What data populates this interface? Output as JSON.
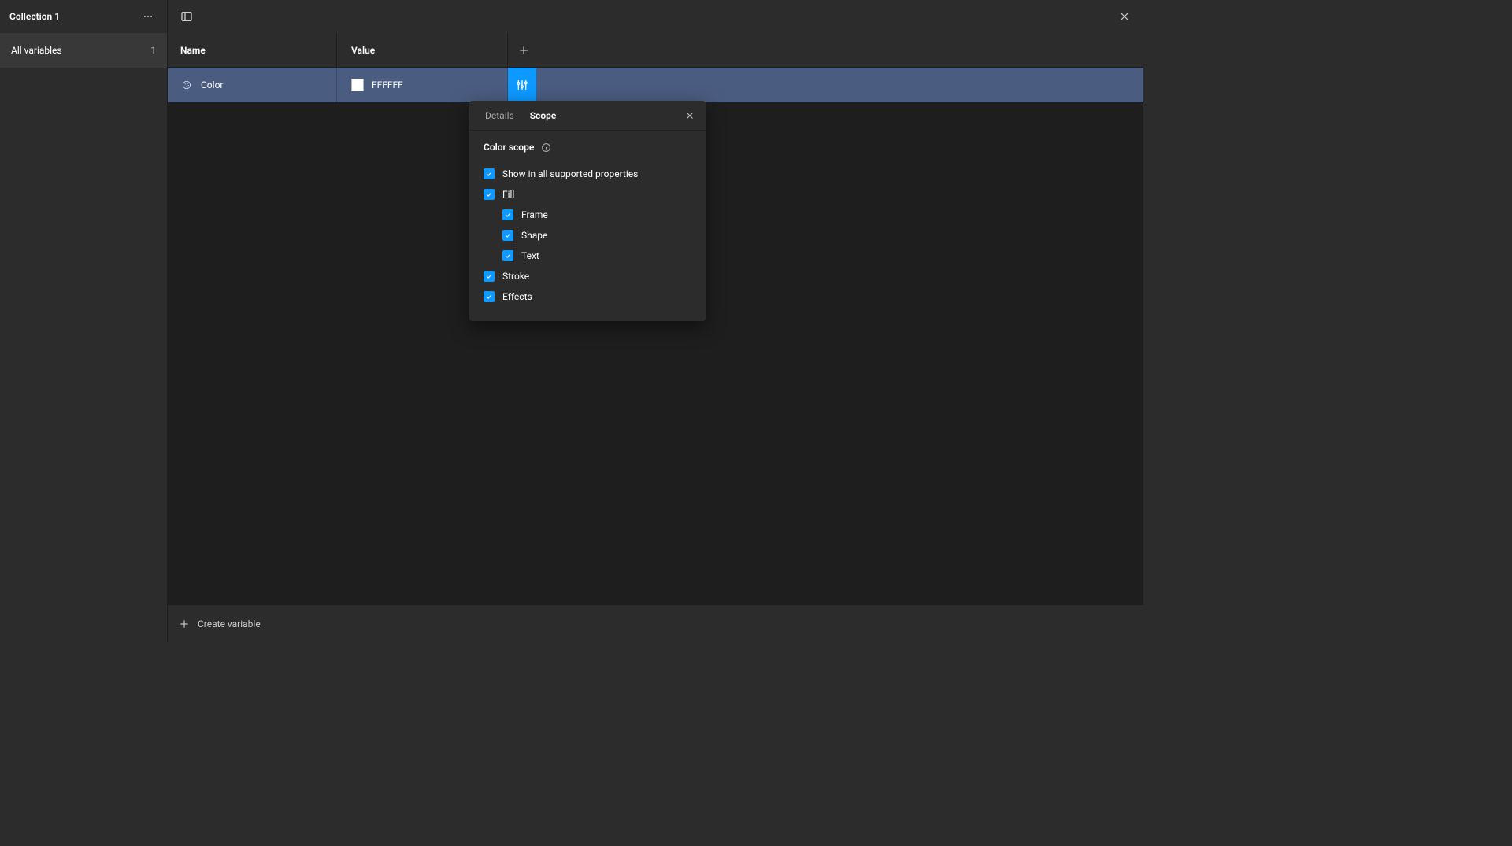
{
  "sidebar": {
    "collection_title": "Collection 1",
    "all_variables_label": "All variables",
    "all_variables_count": "1"
  },
  "table": {
    "columns": {
      "name": "Name",
      "value": "Value"
    },
    "rows": [
      {
        "name": "Color",
        "value_label": "FFFFFF",
        "swatch_hex": "#FFFFFF"
      }
    ]
  },
  "popover": {
    "tabs": {
      "details": "Details",
      "scope": "Scope"
    },
    "active_tab": "scope",
    "section_title": "Color scope",
    "options": {
      "show_all": "Show in all supported properties",
      "fill": "Fill",
      "frame": "Frame",
      "shape": "Shape",
      "text": "Text",
      "stroke": "Stroke",
      "effects": "Effects"
    }
  },
  "footer": {
    "create_variable": "Create variable"
  },
  "colors": {
    "accent": "#0d99ff",
    "selected_row": "#4a5c7f"
  }
}
